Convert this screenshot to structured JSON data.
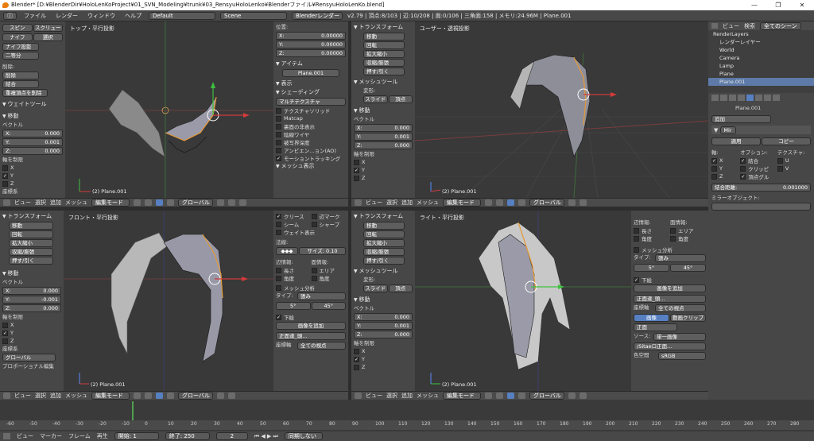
{
  "window": {
    "title": "Blender* [D:¥BlenderDir¥HoloLenKoProject¥01_SVN_Modeling¥trunk¥03_RensyuHoloLenko¥Blenderファイル¥RensyuHoloLenKo.blend]"
  },
  "infobar": {
    "menus": [
      "ファイル",
      "レンダー",
      "ウィンドウ",
      "ヘルプ"
    ],
    "layout": "Default",
    "scene": "Scene",
    "engine": "Blenderレンダー",
    "stats": "v2.79 | 頂点:8/103 | 辺:10/208 | 面:0/106 | 三角面:158 | メモリ:24.96M | Plane.001"
  },
  "viewports": {
    "top_left": {
      "label": "トップ・平行投影",
      "object": "(2) Plane.001"
    },
    "top_right": {
      "label": "ユーザー・透視投影",
      "object": "(2) Plane.001"
    },
    "bottom_left": {
      "label": "フロント・平行投影",
      "object": "(2) Plane.001"
    },
    "bottom_right": {
      "label": "ライト・平行投影",
      "object": "(2) Plane.001"
    }
  },
  "header": {
    "view": "ビュー",
    "select": "選択",
    "add": "追加",
    "mesh": "メッシュ",
    "mode": "編集モード",
    "orient": "グローバル"
  },
  "toolshelf": {
    "tl_buttons_top": [
      "スピン",
      "スクリュー",
      "ナイフ",
      "選択",
      "ナイフ投影",
      "二等分"
    ],
    "tl_delete": "削除:",
    "tl_delete_items": [
      "削除",
      "結合",
      "重複頂点を削除"
    ],
    "weight": "ウェイトツール",
    "move": "移動",
    "vector": "ベクトル",
    "x": "X:",
    "y": "Y:",
    "z": "Z:",
    "tl_x": "0.000",
    "tl_y": "0.001",
    "tl_z": "0.000",
    "constraint": "軸を制限",
    "ax_x": "X",
    "ax_y": "Y",
    "ax_z": "Z",
    "coord": "座標系",
    "transform": "トランスフォーム",
    "transform_items": [
      "移動",
      "回転",
      "拡大縮小",
      "収縮/膨張",
      "押す/引く"
    ],
    "global": "グローバル",
    "proportional": "プロポーショナル編集",
    "bl_x": "0.000",
    "bl_y": "-0.001",
    "bl_z": "0.000",
    "tr_x": "0.000",
    "tr_y": "0.001",
    "tr_z": "0.000",
    "br_x": "0.000",
    "br_y": "0.001",
    "br_z": "0.000",
    "mesh_tools": "メッシュツール",
    "deform": "変形:",
    "slide": "スライド",
    "vertex": "頂点"
  },
  "npanel_left": {
    "location": "位置:",
    "lx": "0.00000",
    "ly": "0.00000",
    "lz": "0.00000",
    "item": "アイテム",
    "item_name": "Plane.001",
    "display": "表示",
    "shading": "シェーディング",
    "multitex": "マルチテクスチャ",
    "opts": [
      "テクスチャソリッド",
      "Matcap",
      "裏面の非表示",
      "陰線ワイヤ",
      "被写界深度",
      "アンビエン...ョン(AO)"
    ],
    "motion": "モーショントラッキング",
    "mesh_display": "メッシュ表示",
    "overlays": [
      "クリース",
      "辺マーク",
      "シーム",
      "シャープ",
      "ウェイト表示"
    ],
    "normals": "法線:",
    "size": "サイズ: 0.10",
    "edge_info": "辺情報:",
    "face_info": "面情報:",
    "length": "長さ",
    "area": "エリア",
    "angle": "角度",
    "angle2": "角度",
    "mesh_analysis": "メッシュ分析",
    "type": "タイプ:",
    "overhang": "張み",
    "deg5": "5°",
    "deg45": "45°",
    "background": "下絵",
    "add_image": "画像を追加",
    "front_img": "正面達_頭...",
    "axis": "座標軸",
    "all_views": "全ての視点"
  },
  "npanel_right": {
    "edge_info": "辺情報:",
    "face_info": "面情報:",
    "length": "長さ",
    "area": "エリア",
    "angle": "角度",
    "angle2": "角度",
    "mesh_analysis": "メッシュ分析",
    "type": "タイプ:",
    "overhang": "張み",
    "deg5": "5°",
    "deg45": "45°",
    "background": "下絵",
    "add_image": "画像を追加",
    "front_img": "正面達_頭...",
    "axis": "座標軸",
    "all_views": "全ての視点",
    "image": "画像",
    "movie_clip": "動画クリップ",
    "front": "正面",
    "source": "ソース:",
    "single_image": "単一画像",
    "file": "/Sitaeロ正面...",
    "colorspace": "色空間",
    "srgb": "sRGB"
  },
  "outliner": {
    "view": "ビュー",
    "search": "検索",
    "all_scenes": "全てのシーン",
    "items": [
      "RenderLayers",
      "レンダーレイヤー",
      "World",
      "Camera",
      "Lamp",
      "Plane",
      "Plane.001"
    ]
  },
  "properties": {
    "object": "Plane.001",
    "add": "追加",
    "mod_name": "Mir",
    "apply": "適用",
    "copy": "コピー",
    "axis": "軸:",
    "options": "オプション:",
    "texture": "テクスチャ:",
    "x": "X",
    "merge": "結合",
    "u": "U",
    "y": "Y",
    "clipping": "クリッピ",
    "v": "V",
    "z": "Z",
    "vgroups": "頂点グル",
    "merge_limit": "結合距離:",
    "merge_limit_val": "0.001000",
    "mirror_obj": "ミラーオブジェクト:"
  },
  "timeline": {
    "ticks": [
      "-60",
      "-50",
      "-40",
      "-30",
      "-20",
      "-10",
      "0",
      "10",
      "20",
      "30",
      "40",
      "50",
      "60",
      "70",
      "80",
      "90",
      "100",
      "110",
      "120",
      "130",
      "140",
      "150",
      "160",
      "170",
      "180",
      "190",
      "200",
      "210",
      "220",
      "230",
      "240",
      "250",
      "260",
      "270",
      "280"
    ],
    "view": "ビュー",
    "marker": "マーカー",
    "frame": "フレーム",
    "play": "再生",
    "start": "開始:",
    "start_val": "1",
    "end": "終了:",
    "end_val": "250",
    "current": "2",
    "sync": "同期しない"
  }
}
